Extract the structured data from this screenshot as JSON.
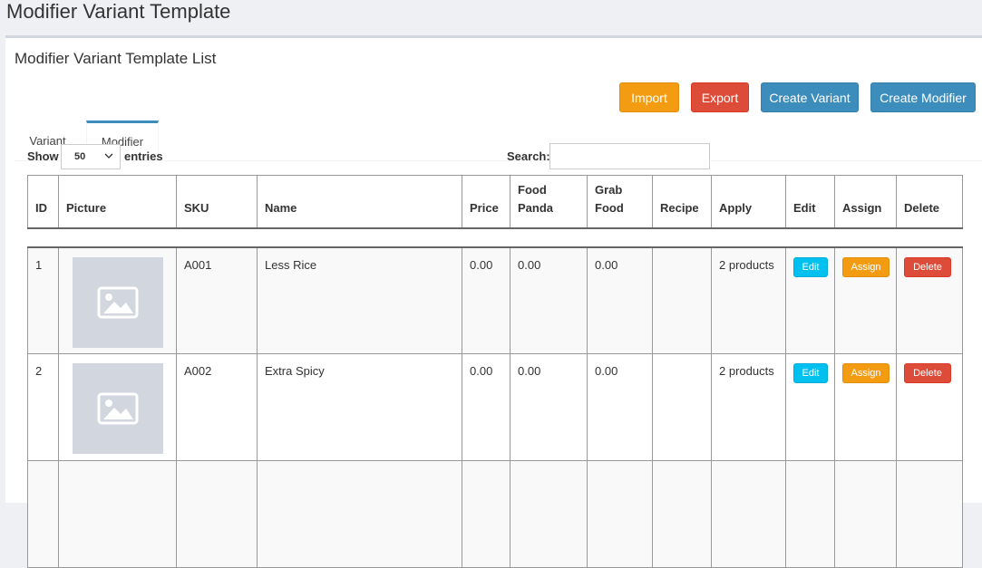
{
  "page": {
    "title": "Modifier Variant Template"
  },
  "card": {
    "title": "Modifier Variant Template List"
  },
  "buttons": {
    "import": "Import",
    "export": "Export",
    "create_variant": "Create Variant",
    "create_modifier": "Create Modifier"
  },
  "tabs": [
    {
      "label": "Variant",
      "active": false
    },
    {
      "label": "Modifier",
      "active": true
    }
  ],
  "table_controls": {
    "show_label": "Show",
    "entries_label": "entries",
    "page_length": "50",
    "search_label": "Search:",
    "search_value": ""
  },
  "table": {
    "headers": {
      "id": "ID",
      "picture": "Picture",
      "sku": "SKU",
      "name": "Name",
      "price": "Price",
      "food_panda_1": "Food",
      "food_panda_2": "Panda",
      "grab_food_1": "Grab",
      "grab_food_2": "Food",
      "recipe": "Recipe",
      "apply": "Apply",
      "edit": "Edit",
      "assign": "Assign",
      "delete": "Delete"
    },
    "rows": [
      {
        "id": "1",
        "sku": "A001",
        "name": "Less Rice",
        "price": "0.00",
        "food_panda": "0.00",
        "grab_food": "0.00",
        "recipe": "",
        "apply": "2 products",
        "edit": "Edit",
        "assign": "Assign",
        "delete": "Delete"
      },
      {
        "id": "2",
        "sku": "A002",
        "name": "Extra Spicy",
        "price": "0.00",
        "food_panda": "0.00",
        "grab_food": "0.00",
        "recipe": "",
        "apply": "2 products",
        "edit": "Edit",
        "assign": "Assign",
        "delete": "Delete"
      }
    ]
  },
  "icons": {
    "picture_placeholder": "image-icon",
    "select_arrow": "chevron-down-icon"
  },
  "colors": {
    "import": "#f39c12",
    "export": "#dd4b39",
    "primary": "#3c8dbc",
    "edit": "#00c0ef",
    "assign": "#f39c12",
    "delete": "#dd4b39"
  }
}
